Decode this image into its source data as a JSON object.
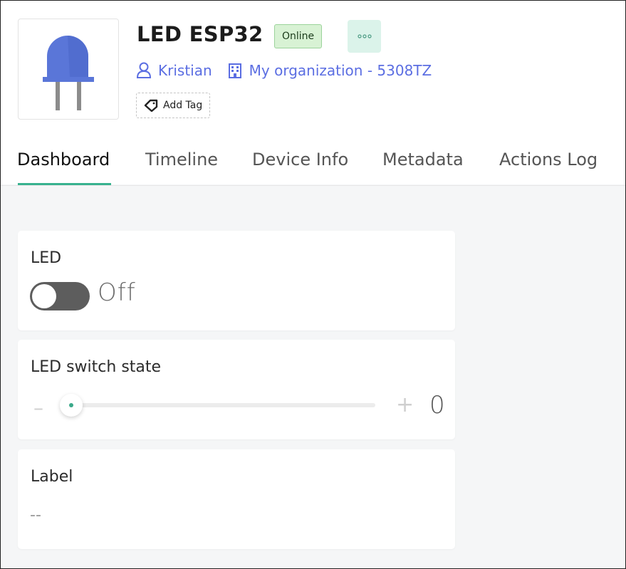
{
  "device": {
    "name": "LED ESP32",
    "status": "Online",
    "owner": "Kristian",
    "organization": "My organization - 5308TZ",
    "add_tag_label": "Add Tag"
  },
  "tabs": [
    "Dashboard",
    "Timeline",
    "Device Info",
    "Metadata",
    "Actions Log"
  ],
  "widgets": {
    "led": {
      "title": "LED",
      "state_text": "Off",
      "on": false
    },
    "switch_state": {
      "title": "LED switch state",
      "minus": "–",
      "plus": "+",
      "value": "0",
      "level": 0
    },
    "label": {
      "title": "Label",
      "value": "--"
    }
  },
  "colors": {
    "accent": "#39b28f",
    "link": "#5b6ee2",
    "online_badge_bg": "#d8f2d4",
    "led_blue": "#5a76d8"
  },
  "icons": {
    "device": "led-bulb-icon",
    "more": "more-dots-icon",
    "owner": "user-icon",
    "organization": "building-icon",
    "tag": "tag-icon"
  }
}
